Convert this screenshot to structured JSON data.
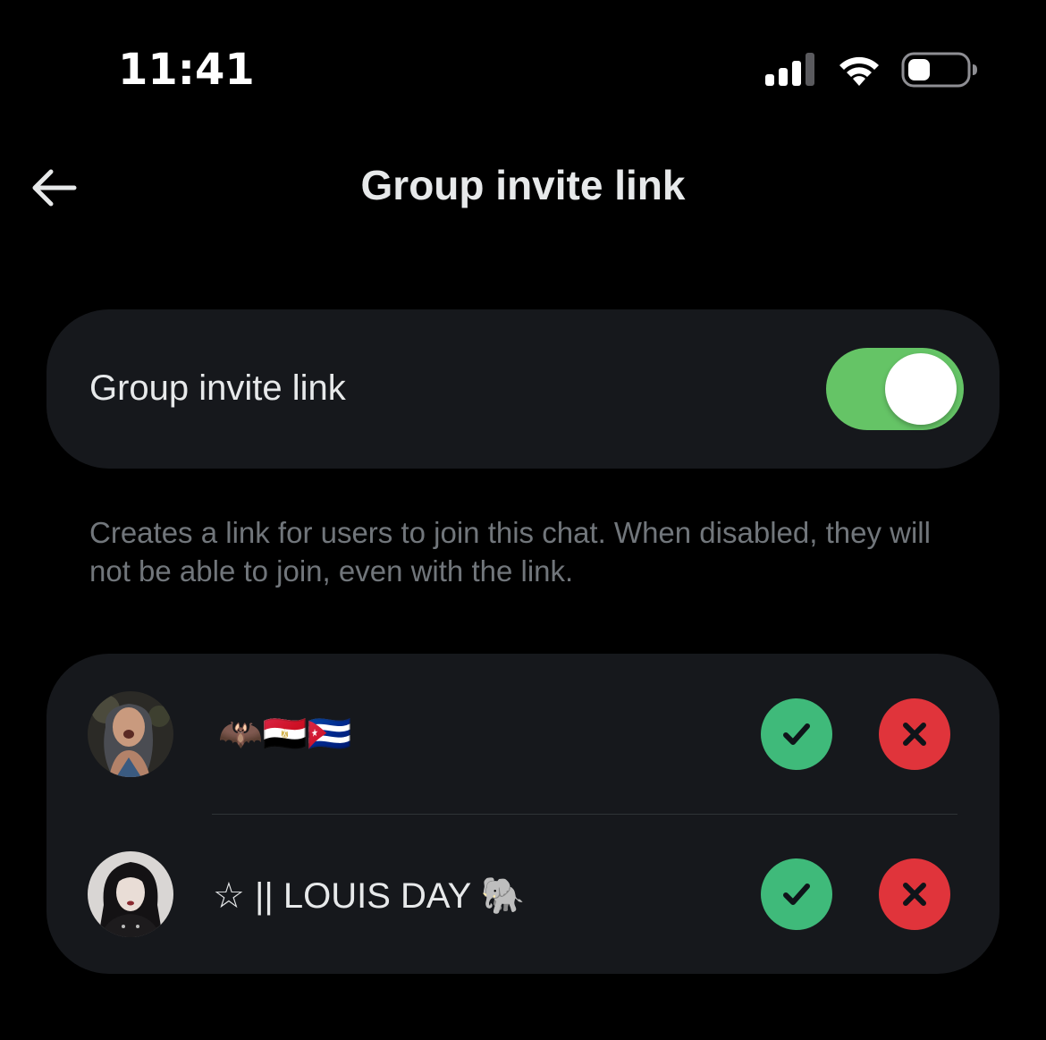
{
  "status_bar": {
    "time": "11:41",
    "signal_icon": "cellular-signal-icon",
    "wifi_icon": "wifi-icon",
    "battery_icon": "battery-low-icon"
  },
  "header": {
    "back_icon": "arrow-left-icon",
    "title": "Group invite link"
  },
  "invite_toggle": {
    "label": "Group invite link",
    "enabled": true,
    "on_color": "#65c466"
  },
  "description": "Creates a link for users to join this chat. When disabled, they will not be able to join, even with the link.",
  "requests": [
    {
      "name": "🦇🇪🇬🇨🇺",
      "avatar_icon": "user-avatar",
      "approve_icon": "checkmark-icon",
      "decline_icon": "x-mark-icon"
    },
    {
      "name": "☆ || LOUIS DAY 🐘",
      "avatar_icon": "user-avatar",
      "approve_icon": "checkmark-icon",
      "decline_icon": "x-mark-icon"
    }
  ],
  "colors": {
    "background": "#000000",
    "card": "#16181c",
    "approve": "#3fba7a",
    "decline": "#e0343b",
    "secondary_text": "#71767b"
  }
}
